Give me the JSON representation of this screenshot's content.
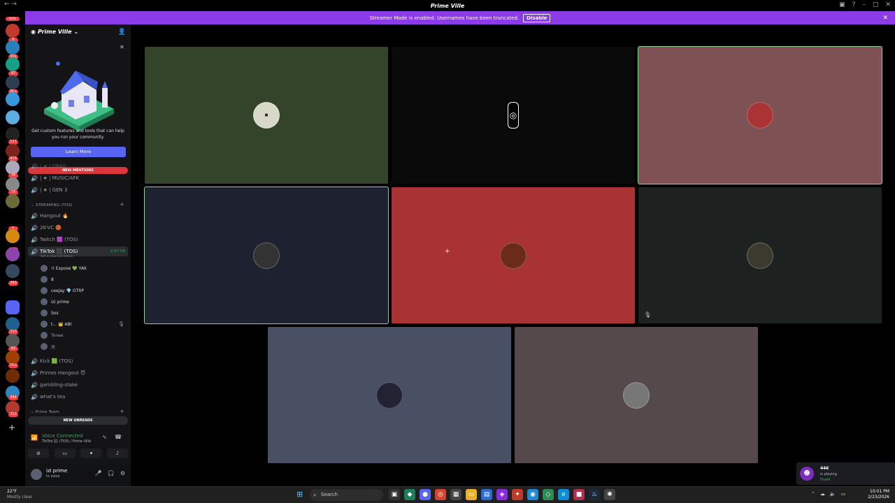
{
  "window": {
    "title": "Prime Ville"
  },
  "banner": {
    "text": "Streamer Mode is enabled. Usernames have been truncated.",
    "button": "Disable"
  },
  "servers": {
    "new_label": "NEW",
    "badges": [
      "8",
      "301",
      "47",
      "3K+",
      "117",
      "616",
      "38",
      "16",
      "5",
      "11",
      "263",
      "210",
      "82",
      "1K+",
      "394",
      "712"
    ]
  },
  "sidebar": {
    "server_name": "Prime Ville",
    "promo": {
      "text": "Get custom features and tools that can help you run your community.",
      "button": "Learn More"
    },
    "new_mentions": "NEW MENTIONS",
    "top_channels": [
      {
        "label": "| ★ | DRAG",
        "icon": "speaker-icon"
      },
      {
        "label": "| ★ | MUSIC/AFK",
        "icon": "speaker-icon"
      },
      {
        "label": "| ★ | GEN 3",
        "icon": "speaker-icon"
      }
    ],
    "category_streaming": "STREAMING (TOS)",
    "streaming_channels": [
      {
        "label": "Hangout 🔥"
      },
      {
        "label": "2K-VC 🏀"
      },
      {
        "label": "Twitch 🟪 (TOS)"
      }
    ],
    "active_channel": {
      "label": "TikTok ⬛ (TOS)",
      "timer": "2:57:56",
      "status": "Set a channel status"
    },
    "voice_users": [
      {
        "name": "!! Expose 💚 YAK"
      },
      {
        "name": "8"
      },
      {
        "name": "ceejay 💎 OTRP"
      },
      {
        "name": "izi prime"
      },
      {
        "name": "Sos"
      },
      {
        "name": "t... 👑 ABI"
      },
      {
        "name": "Tonee"
      },
      {
        "name": "天"
      }
    ],
    "more_channels": [
      {
        "label": "Kick 🟩 (TOS)"
      },
      {
        "label": "Primes Hangout 😈"
      },
      {
        "label": "gambling-stake"
      },
      {
        "label": "what's tea"
      }
    ],
    "category_team": "Prime Team",
    "new_unreads": "NEW UNREADS"
  },
  "voice": {
    "status": "Voice Connected",
    "location": "TikTok ⬛ (TOS) / Prime Ville"
  },
  "user": {
    "name": "izi prime",
    "status": "In voice"
  },
  "tiles": [
    {
      "id": "tile-1",
      "color": "#34442a",
      "speaking": false
    },
    {
      "id": "tile-2",
      "color": "#0a0a0a",
      "speaking": false
    },
    {
      "id": "tile-3",
      "color": "#7e5154",
      "speaking": true
    },
    {
      "id": "tile-4",
      "color": "#1e2230",
      "speaking": true
    },
    {
      "id": "tile-5",
      "color": "#a93232",
      "speaking": false
    },
    {
      "id": "tile-6",
      "color": "#1d211f",
      "speaking": false
    },
    {
      "id": "tile-7",
      "color": "#4a5064",
      "speaking": false
    },
    {
      "id": "tile-8",
      "color": "#55494c",
      "speaking": false
    }
  ],
  "activity": {
    "name": "44€",
    "verb": "is playing",
    "game": "FiveM"
  },
  "taskbar": {
    "weather_temp": "22°F",
    "weather_desc": "Mostly clear",
    "search_placeholder": "Search",
    "time": "10:01 PM",
    "date": "2/23/2026"
  }
}
